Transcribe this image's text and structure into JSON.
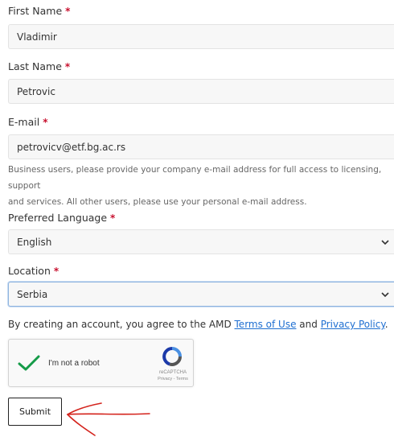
{
  "form": {
    "required_mark": "*",
    "first_name": {
      "label": "First Name",
      "value": "Vladimir"
    },
    "last_name": {
      "label": "Last Name",
      "value": "Petrovic"
    },
    "email": {
      "label": "E-mail",
      "value": "petrovicv@etf.bg.ac.rs",
      "help_line1": "Business users, please provide your company e-mail address for full access to licensing, support",
      "help_line2": "and services. All other users, please use your personal e-mail address."
    },
    "preferred_language": {
      "label": "Preferred Language",
      "selected": "English"
    },
    "location": {
      "label": "Location",
      "selected": "Serbia"
    },
    "agreement": {
      "prefix": "By creating an account, you agree to the AMD ",
      "terms_link": "Terms of Use",
      "middle": " and ",
      "privacy_link": "Privacy Policy",
      "suffix": "."
    },
    "captcha": {
      "label": "I'm not a robot",
      "brand": "reCAPTCHA",
      "links": "Privacy - Terms",
      "checked": true
    },
    "submit_label": "Submit"
  },
  "colors": {
    "required": "#c8102e",
    "link": "#1f6fd1",
    "checkmark": "#159b48",
    "annotation_arrow": "#d4231c",
    "focus_border": "#8fb4df"
  }
}
